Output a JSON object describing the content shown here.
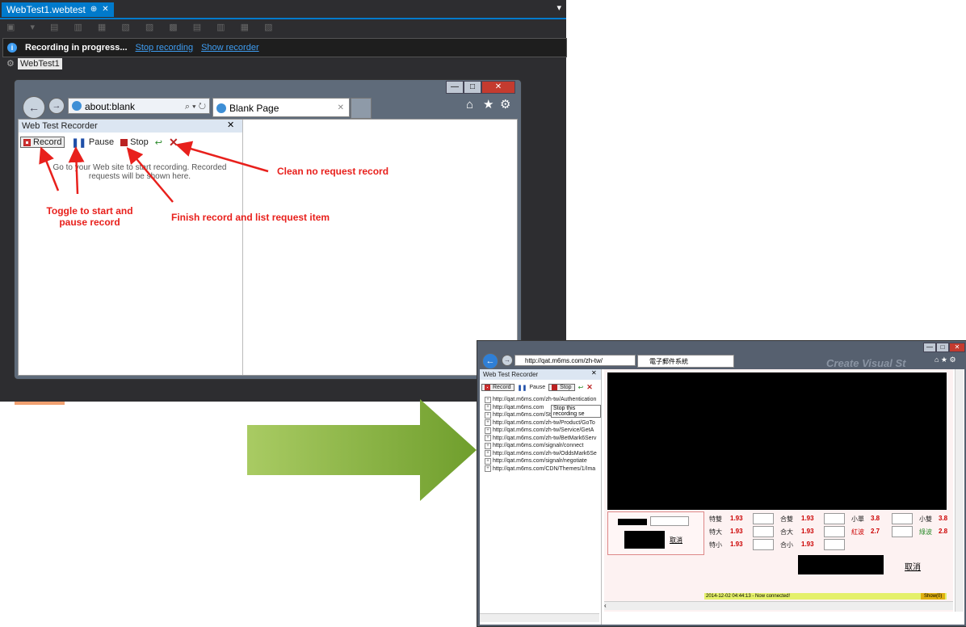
{
  "vs": {
    "tab_label": "WebTest1.webtest",
    "tab_pin": "⊕",
    "tab_close": "✕",
    "dropdown": "▾",
    "info_text": "Recording in progress...",
    "stop_recording": "Stop recording",
    "show_recorder": "Show recorder",
    "doc_label": "WebTest1"
  },
  "ie": {
    "address": "about:blank",
    "tab_title": "Blank Page",
    "tab_close": "✕",
    "search_glyph": "⌕ ▾ ↻"
  },
  "recorder": {
    "title": "Web Test Recorder",
    "close": "✕",
    "record": "Record",
    "pause": "Pause",
    "stop": "Stop",
    "hint_line1": "Go to your Web site to start recording.  Recorded",
    "hint_line2": "requests will be shown here."
  },
  "annotations": {
    "toggle_1": "Toggle to start and",
    "toggle_2": "pause record",
    "finish": "Finish record and list request item",
    "clean": "Clean no request record"
  },
  "colors": {
    "arrow_green": "#7fb23a",
    "annotation_red": "#e8201c",
    "vs_accent": "#007acc"
  },
  "ie2": {
    "address": "http://qat.m6ms.com/zh-tw/",
    "tab_title": "電子郵件系統",
    "watermark": "Create Visual St",
    "recorder_title": "Web Test Recorder",
    "record": "Record",
    "pause": "Pause",
    "stop": "Stop",
    "tooltip": "Stop this recording se",
    "requests": [
      "http://qat.m6ms.com/zh-tw/Authentication",
      "http://qat.m6ms.com",
      "http://qat.m6ms.com/StaticPages/zh-tw/",
      "http://qat.m6ms.com/zh-tw/Product/GoTo",
      "http://qat.m6ms.com/zh-tw/Service/GetA",
      "http://qat.m6ms.com/zh-tw/BetMark6Serv",
      "http://qat.m6ms.com/signalr/connect",
      "http://qat.m6ms.com/zh-tw/OddsMark6Se",
      "http://qat.m6ms.com/signalr/negotiate",
      "http://qat.m6ms.com/CDN/Themes/1/Ima"
    ],
    "cancel": "取消",
    "odds_rows": [
      {
        "l1": "特雙",
        "v1": "1.93",
        "l2": "合雙",
        "v2": "1.93",
        "l3": "小單",
        "v3": "3.8",
        "l4": "小雙",
        "v4": "3.8"
      },
      {
        "l1": "特大",
        "v1": "1.93",
        "l2": "合大",
        "v2": "1.93",
        "l3": "紅波",
        "v3": "2.7",
        "l4": "綠波",
        "v4": "2.8"
      },
      {
        "l1": "特小",
        "v1": "1.93",
        "l2": "合小",
        "v2": "1.93"
      }
    ],
    "status": "2014-12-02 04:44:13 - Now connected!",
    "show": "Show(0)"
  }
}
